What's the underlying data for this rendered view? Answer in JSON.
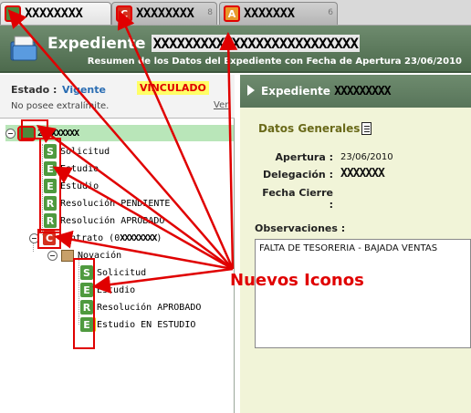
{
  "tabs": [
    {
      "label": "XXXXXXXX",
      "icon": "folder-icon",
      "active": true
    },
    {
      "label": "XXXXXXXX",
      "icon": "contract-c-icon",
      "badge": "C",
      "number": "8",
      "active": false
    },
    {
      "label": "XXXXXXX",
      "icon": "alert-a-icon",
      "badge": "A",
      "number": "6",
      "active": false
    }
  ],
  "banner": {
    "title": "Expediente",
    "id": "XXXXXXXXXXXXXXXXXXXXXXXXXX",
    "subtitle": "Resumen de los Datos del Expediente con Fecha de Apertura 23/06/2010"
  },
  "status": {
    "label": "Estado :",
    "value": "Vigente",
    "badge": "VINCULADO",
    "limit_text": "No posee extralímite.",
    "link": "Ver"
  },
  "tree": {
    "root": {
      "label": "2XXXXXXXX"
    },
    "items": [
      {
        "icon": "S",
        "label": "Solicitud"
      },
      {
        "icon": "E",
        "label": "Estudio"
      },
      {
        "icon": "E",
        "label": "Estudio"
      },
      {
        "icon": "R",
        "label": "Resolución PENDIENTE"
      },
      {
        "icon": "R",
        "label": "Resolución APROBADO"
      }
    ],
    "contrato": {
      "icon": "C",
      "label": "Contrato (0",
      "id": "XXXXXXXX",
      "suffix": ")"
    },
    "novacion": {
      "label": "Novación"
    },
    "novacion_items": [
      {
        "icon": "S",
        "label": "Solicitud"
      },
      {
        "icon": "E",
        "label": "Estudio"
      },
      {
        "icon": "R",
        "label": "Resolución APROBADO"
      },
      {
        "icon": "E",
        "label": "Estudio EN ESTUDIO"
      }
    ]
  },
  "right": {
    "title": "Expediente",
    "title_id": "XXXXXXXXX",
    "section": "Datos Generales",
    "fields": {
      "apertura_label": "Apertura :",
      "apertura_value": "23/06/2010",
      "delegacion_label": "Delegación :",
      "delegacion_value": "XXXXXXX",
      "cierre_label": "Fecha Cierre :",
      "cierre_value": ""
    },
    "observaciones_label": "Observaciones :",
    "observaciones_value": "FALTA DE TESORERIA - BAJADA VENTAS"
  },
  "annotation": {
    "text": "Nuevos Iconos",
    "color": "#e00000"
  },
  "colors": {
    "header_green": "#58755a",
    "tree_selected": "#b9e6b9",
    "right_bg": "#f1f4d8",
    "icon_green": "#4f9a3f",
    "icon_red": "#d4311e",
    "vinculado_bg": "#ffff66"
  }
}
